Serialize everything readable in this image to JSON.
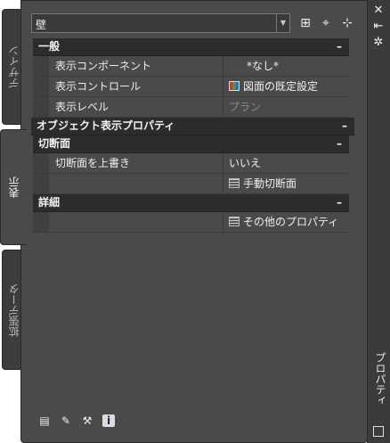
{
  "window": {
    "title": "プロパティ",
    "controls": {
      "close_glyph": "✕",
      "autohide_glyph": "⇤",
      "settings_glyph": "✲"
    }
  },
  "side_tabs": [
    {
      "label": "デザイン",
      "active": false
    },
    {
      "label": "表示",
      "active": true
    },
    {
      "label": "拡張データ",
      "active": false
    }
  ],
  "object_selector": {
    "value": "壁",
    "buttons": [
      {
        "icon": "quick-select-icon",
        "glyph": "⊞"
      },
      {
        "icon": "select-objects-icon",
        "glyph": "⌖"
      },
      {
        "icon": "toggle-pickadd-icon",
        "glyph": "⊹"
      }
    ]
  },
  "sections": {
    "general": {
      "title": "一般",
      "collapse": "–",
      "rows": [
        {
          "name": "表示コンポーネント",
          "value": "*なし*"
        },
        {
          "name": "表示コントロール",
          "value": "図面の既定設定",
          "icon": "display-control-icon"
        },
        {
          "name": "表示レベル",
          "value": "プラン"
        }
      ]
    },
    "object_display": {
      "title": "オブジェクト表示プロパティ",
      "collapse": "–"
    },
    "cut_plane": {
      "title": "切断面",
      "collapse": "–",
      "rows": [
        {
          "name": "切断面を上書き",
          "value": "いいえ"
        },
        {
          "name": "",
          "value": "手動切断面",
          "icon": "list-icon"
        }
      ]
    },
    "details": {
      "title": "詳細",
      "collapse": "–",
      "rows": [
        {
          "name": "",
          "value": "その他のプロパティ",
          "icon": "list-icon"
        }
      ]
    }
  },
  "bottom_toolbar": [
    {
      "icon": "edit-object-display-icon",
      "glyph": "▤"
    },
    {
      "icon": "edit-properties-icon",
      "glyph": "✎"
    },
    {
      "icon": "match-properties-icon",
      "glyph": "⚒"
    },
    {
      "icon": "info-icon",
      "glyph": "i"
    }
  ]
}
